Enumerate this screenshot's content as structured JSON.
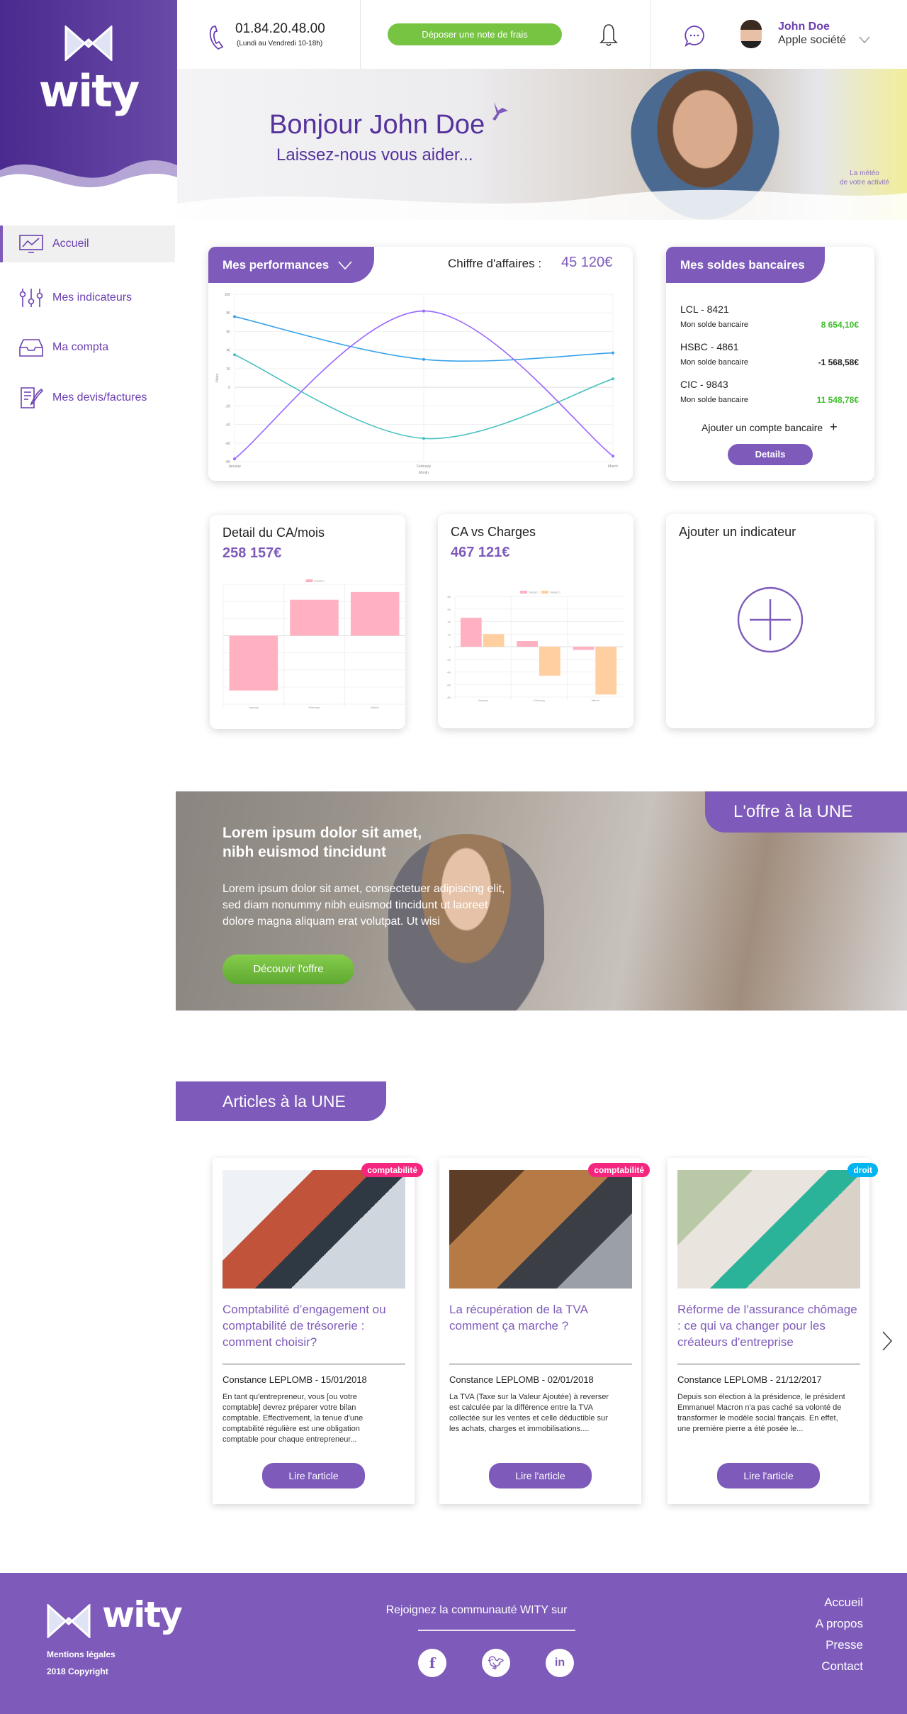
{
  "brand": {
    "name": "wity",
    "primary": "#7e5bba",
    "green": "#76c442"
  },
  "header": {
    "phone": "01.84.20.48.00",
    "hours": "(Lundi au Vendredi 10-18h)",
    "cta": "Déposer une note de frais",
    "user_name": "John Doe",
    "company": "Apple société",
    "icons": [
      "phone-icon",
      "bell-icon",
      "chat-icon",
      "avatar",
      "chevron-down-icon"
    ]
  },
  "hero": {
    "title": "Bonjour John Doe",
    "subtitle": "Laissez-nous vous aider...",
    "meteo_line1": "La météo",
    "meteo_line2": "de votre activité"
  },
  "sidebar": {
    "items": [
      {
        "label": "Accueil",
        "icon": "monitor-chart-icon",
        "active": true
      },
      {
        "label": "Mes indicateurs",
        "icon": "sliders-icon"
      },
      {
        "label": "Ma compta",
        "icon": "inbox-icon"
      },
      {
        "label": "Mes devis/factures",
        "icon": "document-edit-icon"
      }
    ]
  },
  "performances": {
    "tab": "Mes performances",
    "ca_label": "Chiffre d'affaires :",
    "ca_value": "45 120€"
  },
  "bank": {
    "title": "Mes soldes bancaires",
    "accounts": [
      {
        "name": "LCL - 8421",
        "label": "Mon solde bancaire",
        "value": "8 654,10€",
        "color": "#3fbf2c"
      },
      {
        "name": "HSBC - 4861",
        "label": "Mon solde bancaire",
        "value": "-1 568,58€",
        "color": "#222222"
      },
      {
        "name": "CIC - 9843",
        "label": "Mon solde bancaire",
        "value": "11 548,78€",
        "color": "#3fbf2c"
      }
    ],
    "add": "Ajouter un compte bancaire",
    "details": "Details"
  },
  "mini": {
    "ca_title": "Detail du CA/mois",
    "ca_value": "258 157€",
    "vs_title": "CA vs Charges",
    "vs_value": "467 121€",
    "add_title": "Ajouter un indicateur"
  },
  "chart_data": [
    {
      "type": "line",
      "categories": [
        "January",
        "February",
        "March"
      ],
      "xlabel": "Month",
      "ylabel": "Value",
      "ylim": [
        -80,
        100
      ],
      "yticks": [
        100,
        80,
        60,
        40,
        20,
        0,
        -20,
        -40,
        -60,
        -80
      ],
      "grid": true,
      "series": [
        {
          "values": [
            76,
            30,
            37
          ],
          "color": "#36a2eb"
        },
        {
          "values": [
            35,
            -55,
            9
          ],
          "color": "#4bc0c0"
        },
        {
          "values": [
            -77,
            82,
            -74
          ],
          "color": "#9966ff"
        }
      ]
    },
    {
      "type": "bar",
      "categories": [
        "January",
        "February",
        "March"
      ],
      "ylim": [
        -80,
        60
      ],
      "grid": true,
      "legend": "top",
      "series": [
        {
          "name": "Dataset 1",
          "values": [
            -64,
            42,
            51
          ],
          "color": "#ffb1c1"
        }
      ]
    },
    {
      "type": "bar",
      "categories": [
        "January",
        "February",
        "March"
      ],
      "ylim": [
        -80,
        80
      ],
      "yticks": [
        80,
        60,
        40,
        20,
        0,
        -20,
        -40,
        -60,
        -80
      ],
      "grid": true,
      "legend": "top",
      "series": [
        {
          "name": "Dataset 1",
          "values": [
            46,
            9,
            -5
          ],
          "color": "#ffb1c1"
        },
        {
          "name": "Dataset 2",
          "values": [
            20,
            -46,
            -76
          ],
          "color": "#ffcf9f"
        }
      ]
    }
  ],
  "offer": {
    "tag": "L'offre à la UNE",
    "title1": "Lorem ipsum dolor sit amet,",
    "title2": "nibh euismod tincidunt",
    "text": "Lorem ipsum dolor sit amet, consectetuer adipiscing elit, sed diam nonummy nibh euismod tincidunt ut laoreet dolore magna aliquam erat volutpat. Ut wisi",
    "button": "Découvir l'offre"
  },
  "articles": {
    "title": "Articles à la UNE",
    "items": [
      {
        "tag": "comptabilité",
        "tag_color": "#f5267f",
        "title": "Comptabilité d’engagement ou comptabilité de trésorerie : comment choisir?",
        "author": "Constance LEPLOMB - 15/01/2018",
        "text": "En tant qu'entrepreneur, vous [ou votre comptable]  devrez préparer votre bilan comptable.  Effectivement, la tenue d'une comptabilité régulière est une obligation comptable pour chaque entrepreneur...",
        "button": "Lire l'article"
      },
      {
        "tag": "comptabilité",
        "tag_color": "#f5267f",
        "title": "La récupération de la TVA comment ça marche ?",
        "author": "Constance LEPLOMB - 02/01/2018",
        "text": "La TVA (Taxe sur la Valeur Ajoutée) à reverser est calculée par la différence entre la TVA collectée sur les ventes et celle déductible sur les achats, charges et immobilisations....",
        "button": "Lire l'article"
      },
      {
        "tag": "droit",
        "tag_color": "#00b4f0",
        "title": "Réforme de l'assurance chômage : ce qui va changer pour les créateurs d'entreprise",
        "author": "Constance LEPLOMB - 21/12/2017",
        "text": "Depuis son élection à la présidence, le président Emmanuel Macron n'a pas caché sa volonté de transformer le modèle social français. En effet, une première pierre a été posée le...",
        "button": "Lire l'article"
      }
    ]
  },
  "footer": {
    "legal": "Mentions légales",
    "copyright": "2018 Copyright",
    "join": "Rejoignez la communauté WITY sur",
    "links": [
      "Accueil",
      "A propos",
      "Presse",
      "Contact"
    ],
    "social": [
      "facebook-icon",
      "twitter-icon",
      "linkedin-icon"
    ]
  }
}
